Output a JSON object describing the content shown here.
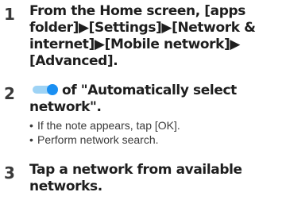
{
  "steps": [
    {
      "number": "1",
      "lines": [
        "From the Home screen, [apps",
        "folder]▶[Settings]▶[Network &",
        "internet]▶[Mobile network]▶",
        "[Advanced]."
      ]
    },
    {
      "number": "2",
      "line1": "of \"Automatically select",
      "line2": "network\".",
      "toggle_icon": "toggle-switch-on-icon",
      "bullets": [
        "If the note appears, tap [OK].",
        "Perform network search."
      ]
    },
    {
      "number": "3",
      "lines": [
        "Tap a network from available",
        "networks."
      ]
    }
  ],
  "bullet_symbol": "•",
  "colors": {
    "text": "#1e1e1e",
    "number": "#3a3a3a",
    "toggle_knob": "#1a8ff2",
    "toggle_track": "#9ed3f5"
  }
}
